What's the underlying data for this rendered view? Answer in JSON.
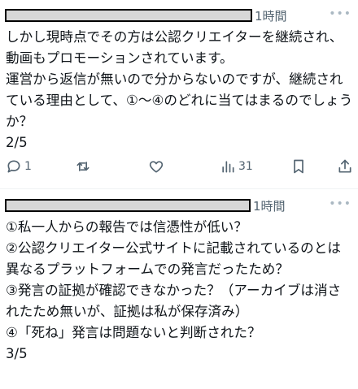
{
  "tweet1": {
    "time": "1時間",
    "more_icon": "ellipsis-icon",
    "body": "しかし現時点でその方は公認クリエイターを継続され、動画もプロモーションされています。\n運営から返信が無いので分からないのですが、継続されている理由として、①〜④のどれに当てはまるのでしょうか？\n2/5",
    "actions": {
      "reply_count": "1",
      "retweet_count": "",
      "like_count": "",
      "views_count": "31"
    }
  },
  "tweet2": {
    "time": "1時間",
    "more_icon": "ellipsis-icon",
    "body": "①私一人からの報告では信憑性が低い？\n②公認クリエイター公式サイトに記載されているのとは異なるプラットフォームでの発言だったため？\n③発言の証拠が確認できなかった？（アーカイブは消されたため無いが、証拠は私が保存済み）\n④「死ね」発言は問題ないと判断された？\n3/5"
  }
}
